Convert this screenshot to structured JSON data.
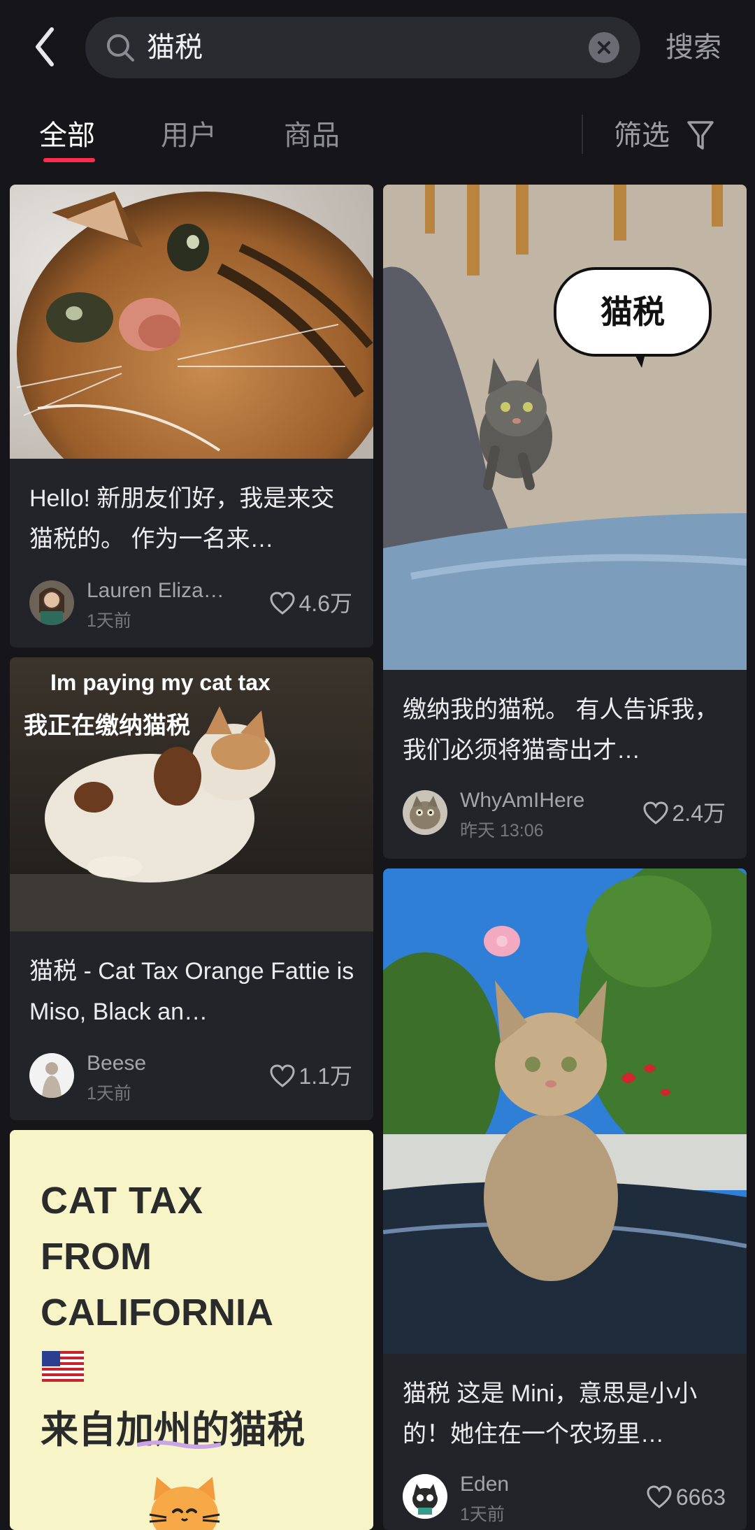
{
  "search": {
    "query": "猫税",
    "button_label": "搜索"
  },
  "tabs": [
    {
      "label": "全部",
      "active": true
    },
    {
      "label": "用户",
      "active": false
    },
    {
      "label": "商品",
      "active": false
    }
  ],
  "filter_label": "筛选",
  "accent_color": "#ff2c4e",
  "cards": [
    {
      "title": "Hello! 新朋友们好，我是来交猫税的。 作为一名来…",
      "author": "Lauren Eliza…",
      "time": "1天前",
      "likes": "4.6万"
    },
    {
      "title": "缴纳我的猫税。 有人告诉我，我们必须将猫寄出才…",
      "author": "WhyAmIHere",
      "time": "昨天 13:06",
      "likes": "2.4万",
      "image_text": "猫税"
    },
    {
      "title": "猫税 - Cat Tax Orange Fattie is Miso, Black an…",
      "author": "Beese",
      "time": "1天前",
      "likes": "1.1万",
      "image_text_en": "Im paying my cat tax",
      "image_text_cn": "我正在缴纳猫税"
    },
    {
      "title": "猫税 这是 Mini，意思是小小的！她住在一个农场里…",
      "author": "Eden",
      "time": "1天前",
      "likes": "6663"
    },
    {
      "image_lines": [
        "CAT  TAX",
        "FROM",
        "CALIFORNIA",
        "来自加州的猫税"
      ]
    }
  ]
}
